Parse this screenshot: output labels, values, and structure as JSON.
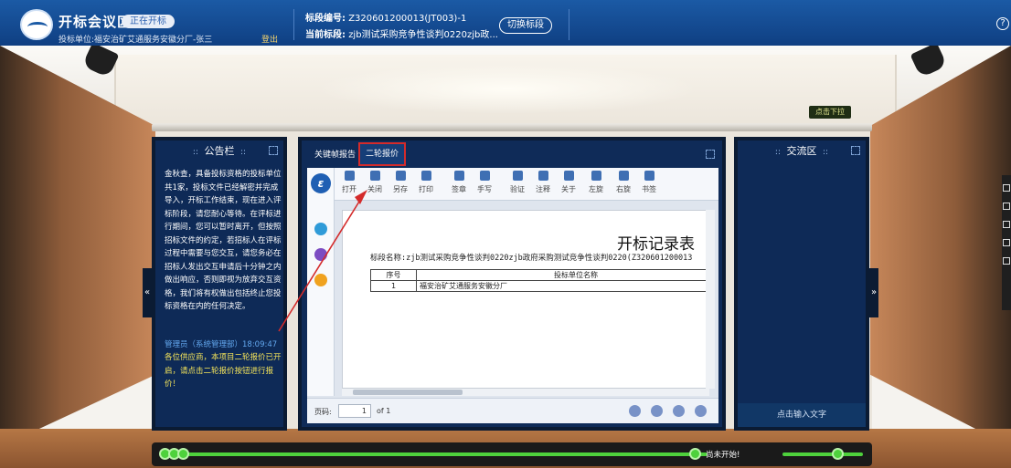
{
  "header": {
    "app_title": "开标会议区",
    "status_badge": "正在开标",
    "bidder": "投标单位:福安治矿艾通服务安徽分厂-张三",
    "logout": "登出",
    "section_no_label": "标段编号:",
    "section_no_value": "Z320601200013(JT003)-1",
    "current_section_label": "当前标段:",
    "current_section_value": "zjb测试采购竞争性谈判0220zjb政...",
    "switch_button": "切换标段",
    "help_icon": "?"
  },
  "scene": {
    "drop_button": "点击下拉"
  },
  "bulletin": {
    "title": "公告栏",
    "dots": "::",
    "text": "金秋查，具备投标资格的投标单位共1家，投标文件已经解密并完成导入，开标工作结束，现在进入评标阶段，请您耐心等待。在评标进行期间，您可以暂时离开，但按照招标文件的约定，若招标人在评标过程中需要与您交互，请您务必在招标人发出交互申请后十分钟之内做出响应，否则即视为放弃交互资格，我们将有权做出包括终止您投标资格在内的任何决定。",
    "admin_line": "管理员（系统管理部）18:09:47",
    "admin_msg": "各位供应商，本项目二轮报价已开启，请点击二轮报价按钮进行报价！"
  },
  "chat": {
    "title": "交流区",
    "dots": "::",
    "input_placeholder": "点击输入文字"
  },
  "document": {
    "tabs": [
      "关键帧报告",
      "二轮报价"
    ],
    "toolbar": [
      "打开",
      "关闭",
      "另存",
      "打印",
      "签章",
      "手写",
      "验证",
      "注释",
      "关于",
      "左旋",
      "右旋",
      "书签"
    ],
    "doc_title": "开标记录表",
    "section_name": "标段名称:zjb测试采购竞争性谈判0220zjb政府采购测试竞争性谈判0220(Z320601200013",
    "table_headers": [
      "序号",
      "投标单位名称"
    ],
    "table_rows": [
      [
        "1",
        "福安治矿艾通服务安徽分厂"
      ]
    ],
    "page_label": "页码:",
    "page_value": "1",
    "page_total": "of 1",
    "logo_letter": "ε"
  },
  "progress": {
    "status": "尚未开始!"
  },
  "colors": {
    "header": "#1b5aa5",
    "panel": "#0e2a57",
    "admin_msg": "#f3e35a",
    "progress": "#4ed13c",
    "highlight": "#d42b2b"
  }
}
